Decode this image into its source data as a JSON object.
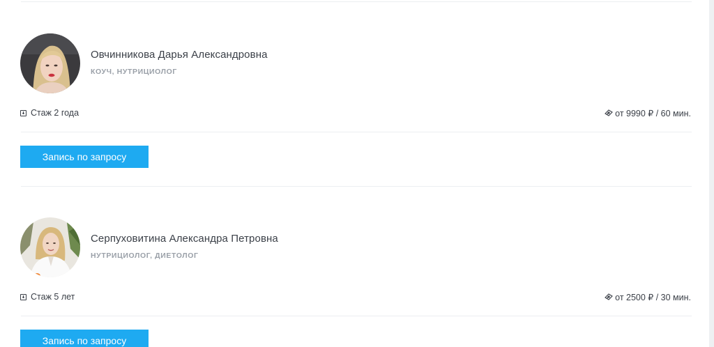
{
  "specialists": [
    {
      "name": "Овчинникова Дарья Александровна",
      "role": "КОУЧ, НУТРИЦИОЛОГ",
      "experience": "Стаж 2 года",
      "price": "от 9990 ₽ / 60 мин.",
      "button_label": "Запись по запросу"
    },
    {
      "name": "Серпуховитина Александра Петровна",
      "role": "НУТРИЦИОЛОГ, ДИЕТОЛОГ",
      "experience": "Стаж 5 лет",
      "price": "от 2500 ₽ / 30 мин.",
      "button_label": "Запись по запросу"
    }
  ],
  "icons": {
    "experience": "plus-square-icon",
    "price": "money-bills-icon"
  },
  "colors": {
    "accent": "#1eaaf1",
    "text": "#3a3f47",
    "muted": "#9aa0a8",
    "divider": "#eceef1"
  }
}
